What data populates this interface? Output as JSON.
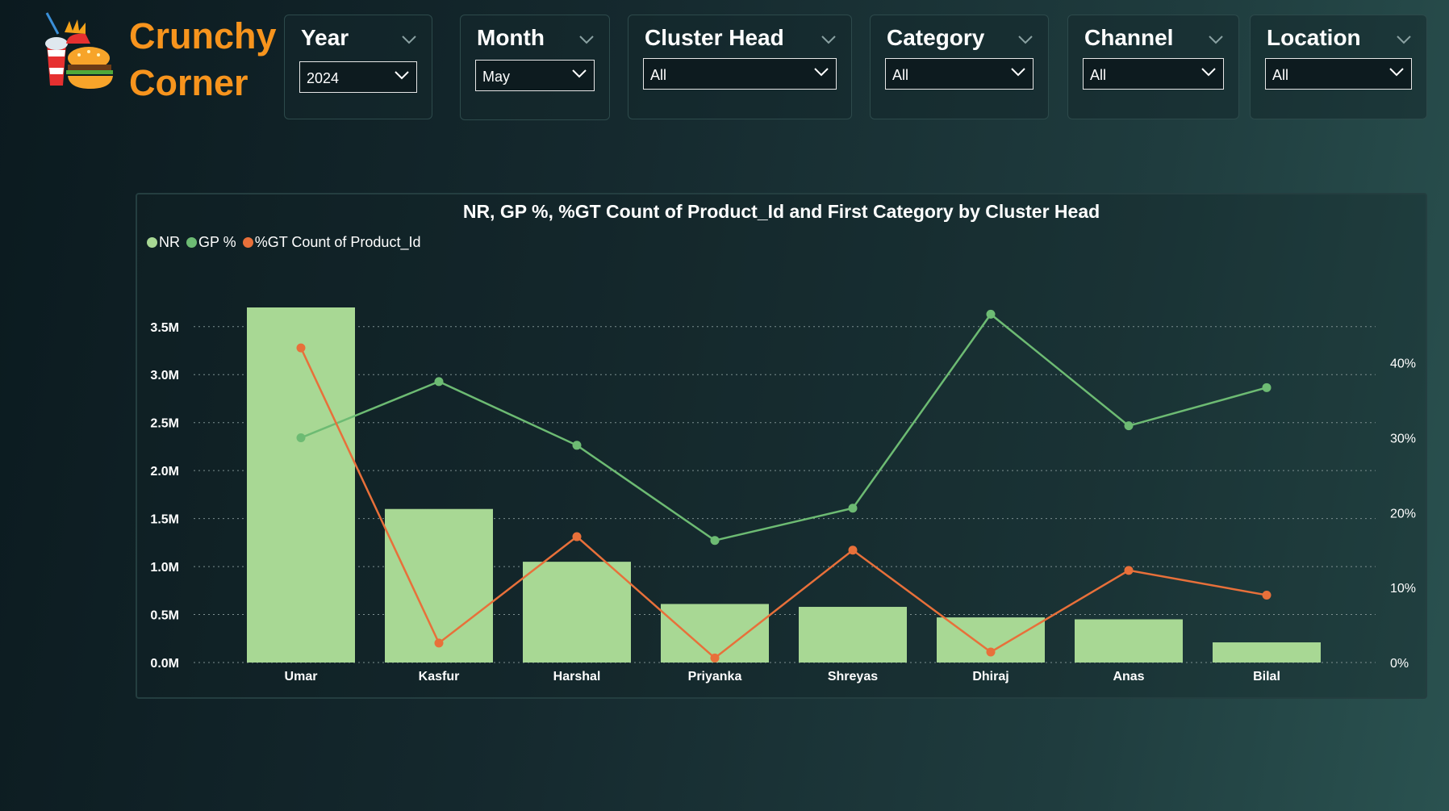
{
  "brand": {
    "line1": "Crunchy",
    "line2": "Corner"
  },
  "slicers": [
    {
      "title": "Year",
      "value": "2024"
    },
    {
      "title": "Month",
      "value": "May"
    },
    {
      "title": "Cluster Head",
      "value": "All"
    },
    {
      "title": "Category",
      "value": "All"
    },
    {
      "title": "Channel",
      "value": "All"
    },
    {
      "title": "Location",
      "value": "All"
    }
  ],
  "colors": {
    "bar": "#a8d894",
    "gp_line": "#6dbb73",
    "gt_line": "#e8703a",
    "brand": "#f7941d"
  },
  "chart_data": {
    "type": "bar",
    "title": "NR, GP %, %GT Count of Product_Id and First Category by Cluster Head",
    "legend": [
      "NR",
      "GP %",
      "%GT Count of Product_Id"
    ],
    "categories": [
      "Umar",
      "Kasfur",
      "Harshal",
      "Priyanka",
      "Shreyas",
      "Dhiraj",
      "Anas",
      "Bilal"
    ],
    "series": [
      {
        "name": "NR",
        "type": "bar",
        "axis": "left",
        "values": [
          3.7,
          1.6,
          1.05,
          0.61,
          0.58,
          0.47,
          0.45,
          0.21
        ]
      },
      {
        "name": "GP %",
        "type": "line",
        "axis": "right",
        "values": [
          30.0,
          37.5,
          29.0,
          16.3,
          20.6,
          46.5,
          31.6,
          36.7
        ]
      },
      {
        "name": "%GT Count of Product_Id",
        "type": "line",
        "axis": "right",
        "values": [
          42.0,
          2.6,
          16.8,
          0.6,
          15.0,
          1.4,
          12.3,
          9.0
        ]
      }
    ],
    "y_left": {
      "ticks": [
        "0.0M",
        "0.5M",
        "1.0M",
        "1.5M",
        "2.0M",
        "2.5M",
        "3.0M",
        "3.5M"
      ],
      "tick_values": [
        0,
        0.5,
        1.0,
        1.5,
        2.0,
        2.5,
        3.0,
        3.5
      ],
      "ylim": [
        0,
        3.5
      ]
    },
    "y_right": {
      "ticks": [
        "0%",
        "10%",
        "20%",
        "30%",
        "40%"
      ],
      "tick_values": [
        0,
        10,
        20,
        30,
        40
      ],
      "ylim": [
        0,
        40
      ]
    },
    "grid": true,
    "legend_position": "top-left"
  }
}
